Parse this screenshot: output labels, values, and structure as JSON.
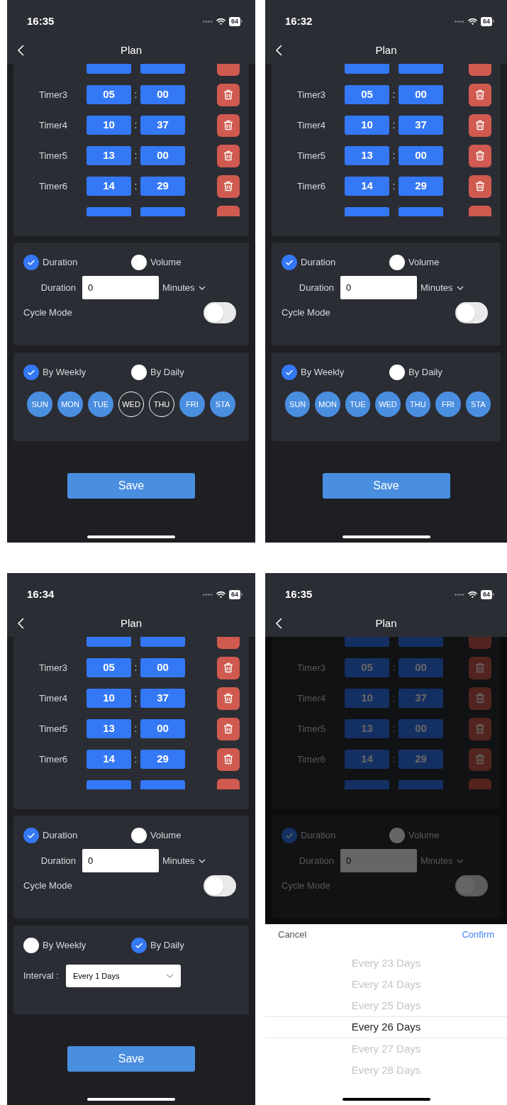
{
  "phones": [
    {
      "status_bar": {
        "time": "16:35",
        "battery": "64"
      },
      "nav": {
        "title": "Plan"
      },
      "dimmed": false,
      "timers": [
        {
          "label": "Timer3",
          "hour": "05",
          "separator": ":",
          "minute": "00"
        },
        {
          "label": "Timer4",
          "hour": "10",
          "separator": ":",
          "minute": "37"
        },
        {
          "label": "Timer5",
          "hour": "13",
          "separator": ":",
          "minute": "00"
        },
        {
          "label": "Timer6",
          "hour": "14",
          "separator": ":",
          "minute": "29"
        }
      ],
      "measure": {
        "options": [
          {
            "label": "Duration",
            "selected": true
          },
          {
            "label": "Volume",
            "selected": false
          }
        ],
        "duration_label": "Duration",
        "duration_value": "0",
        "unit": "Minutes",
        "cycle_mode_label": "Cycle Mode",
        "cycle_mode_on": false
      },
      "schedule": {
        "options": [
          {
            "label": "By Weekly",
            "selected": true
          },
          {
            "label": "By Daily",
            "selected": false
          }
        ],
        "days": [
          {
            "label": "SUN",
            "selected": true
          },
          {
            "label": "MON",
            "selected": true
          },
          {
            "label": "TUE",
            "selected": true
          },
          {
            "label": "WED",
            "selected": false
          },
          {
            "label": "THU",
            "selected": false
          },
          {
            "label": "FRI",
            "selected": true
          },
          {
            "label": "STA",
            "selected": true
          }
        ]
      },
      "save": "Save"
    },
    {
      "status_bar": {
        "time": "16:32",
        "battery": "64"
      },
      "nav": {
        "title": "Plan"
      },
      "dimmed": false,
      "timers": [
        {
          "label": "Timer3",
          "hour": "05",
          "separator": ":",
          "minute": "00"
        },
        {
          "label": "Timer4",
          "hour": "10",
          "separator": ":",
          "minute": "37"
        },
        {
          "label": "Timer5",
          "hour": "13",
          "separator": ":",
          "minute": "00"
        },
        {
          "label": "Timer6",
          "hour": "14",
          "separator": ":",
          "minute": "29"
        }
      ],
      "measure": {
        "options": [
          {
            "label": "Duration",
            "selected": true
          },
          {
            "label": "Volume",
            "selected": false
          }
        ],
        "duration_label": "Duration",
        "duration_value": "0",
        "unit": "Minutes",
        "cycle_mode_label": "Cycle Mode",
        "cycle_mode_on": false
      },
      "schedule": {
        "options": [
          {
            "label": "By Weekly",
            "selected": true
          },
          {
            "label": "By Daily",
            "selected": false
          }
        ],
        "days": [
          {
            "label": "SUN",
            "selected": true
          },
          {
            "label": "MON",
            "selected": true
          },
          {
            "label": "TUE",
            "selected": true
          },
          {
            "label": "WED",
            "selected": true
          },
          {
            "label": "THU",
            "selected": true
          },
          {
            "label": "FRI",
            "selected": true
          },
          {
            "label": "STA",
            "selected": true
          }
        ]
      },
      "save": "Save"
    },
    {
      "status_bar": {
        "time": "16:34",
        "battery": "64"
      },
      "nav": {
        "title": "Plan"
      },
      "dimmed": false,
      "timers": [
        {
          "label": "Timer3",
          "hour": "05",
          "separator": ":",
          "minute": "00"
        },
        {
          "label": "Timer4",
          "hour": "10",
          "separator": ":",
          "minute": "37"
        },
        {
          "label": "Timer5",
          "hour": "13",
          "separator": ":",
          "minute": "00"
        },
        {
          "label": "Timer6",
          "hour": "14",
          "separator": ":",
          "minute": "29"
        }
      ],
      "measure": {
        "options": [
          {
            "label": "Duration",
            "selected": true
          },
          {
            "label": "Volume",
            "selected": false
          }
        ],
        "duration_label": "Duration",
        "duration_value": "0",
        "unit": "Minutes",
        "cycle_mode_label": "Cycle Mode",
        "cycle_mode_on": false
      },
      "schedule": {
        "options": [
          {
            "label": "By Weekly",
            "selected": false
          },
          {
            "label": "By Daily",
            "selected": true
          }
        ],
        "interval": {
          "label": "Interval :",
          "value": "Every 1 Days"
        }
      },
      "save": "Save"
    },
    {
      "status_bar": {
        "time": "16:35",
        "battery": "64"
      },
      "nav": {
        "title": "Plan"
      },
      "dimmed": true,
      "timers": [
        {
          "label": "Timer3",
          "hour": "05",
          "separator": ":",
          "minute": "00"
        },
        {
          "label": "Timer4",
          "hour": "10",
          "separator": ":",
          "minute": "37"
        },
        {
          "label": "Timer5",
          "hour": "13",
          "separator": ":",
          "minute": "00"
        },
        {
          "label": "Timer6",
          "hour": "14",
          "separator": ":",
          "minute": "29"
        }
      ],
      "measure": {
        "options": [
          {
            "label": "Duration",
            "selected": true
          },
          {
            "label": "Volume",
            "selected": false
          }
        ],
        "duration_label": "Duration",
        "duration_value": "0",
        "unit": "Minutes",
        "cycle_mode_label": "Cycle Mode",
        "cycle_mode_on": false
      },
      "picker": {
        "cancel": "Cancel",
        "confirm": "Confirm",
        "items": [
          {
            "label": "Every 23 Days",
            "selected": false
          },
          {
            "label": "Every 24 Days",
            "selected": false
          },
          {
            "label": "Every 25 Days",
            "selected": false
          },
          {
            "label": "Every 26 Days",
            "selected": true
          },
          {
            "label": "Every 27 Days",
            "selected": false
          },
          {
            "label": "Every 28 Days",
            "selected": false
          }
        ]
      }
    }
  ]
}
